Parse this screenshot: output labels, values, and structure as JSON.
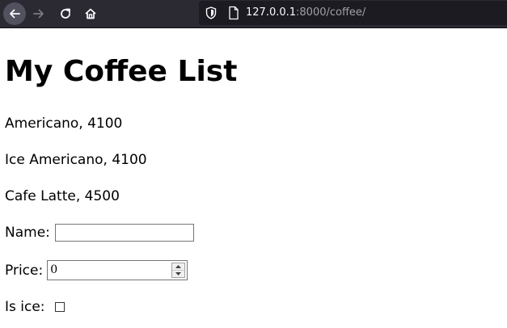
{
  "browser": {
    "url_host": "127.0.0.1",
    "url_rest": ":8000/coffee/",
    "icons": {
      "back": "back-arrow-icon",
      "forward": "forward-arrow-icon",
      "reload": "reload-icon",
      "home": "home-icon",
      "tracking": "shield-icon",
      "page": "page-icon"
    }
  },
  "page": {
    "title": "My Coffee List",
    "coffees": [
      {
        "text": "Americano, 4100"
      },
      {
        "text": "Ice Americano, 4100"
      },
      {
        "text": "Cafe Latte, 4500"
      }
    ]
  },
  "form": {
    "name_label": "Name:",
    "name_value": "",
    "price_label": "Price:",
    "price_value": "0",
    "ice_label": "Is ice:",
    "ice_checked": false
  },
  "colors": {
    "toolbar_bg": "#2b2a33",
    "urlbar_bg": "#1c1b22",
    "url_host": "#fbfbfe",
    "url_rest": "#a0a0a8"
  }
}
